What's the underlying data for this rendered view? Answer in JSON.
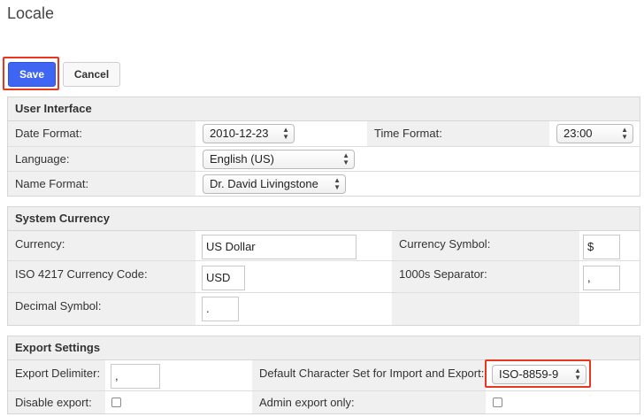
{
  "page": {
    "title": "Locale"
  },
  "toolbar": {
    "save_label": "Save",
    "cancel_label": "Cancel"
  },
  "user_interface": {
    "header": "User Interface",
    "date_format_label": "Date Format:",
    "date_format_value": "2010-12-23",
    "time_format_label": "Time Format:",
    "time_format_value": "23:00",
    "language_label": "Language:",
    "language_value": "English (US)",
    "name_format_label": "Name Format:",
    "name_format_value": "Dr. David Livingstone"
  },
  "system_currency": {
    "header": "System Currency",
    "currency_label": "Currency:",
    "currency_value": "US Dollar",
    "currency_symbol_label": "Currency Symbol:",
    "currency_symbol_value": "$",
    "iso_code_label": "ISO 4217 Currency Code:",
    "iso_code_value": "USD",
    "separator_label": "1000s Separator:",
    "separator_value": ",",
    "decimal_label": "Decimal Symbol:",
    "decimal_value": "."
  },
  "export_settings": {
    "header": "Export Settings",
    "delimiter_label": "Export Delimiter:",
    "delimiter_value": ",",
    "charset_label": "Default Character Set for Import and Export:",
    "charset_value": "ISO-8859-9",
    "disable_export_label": "Disable export:",
    "disable_export_checked": false,
    "admin_export_label": "Admin export only:",
    "admin_export_checked": false
  }
}
